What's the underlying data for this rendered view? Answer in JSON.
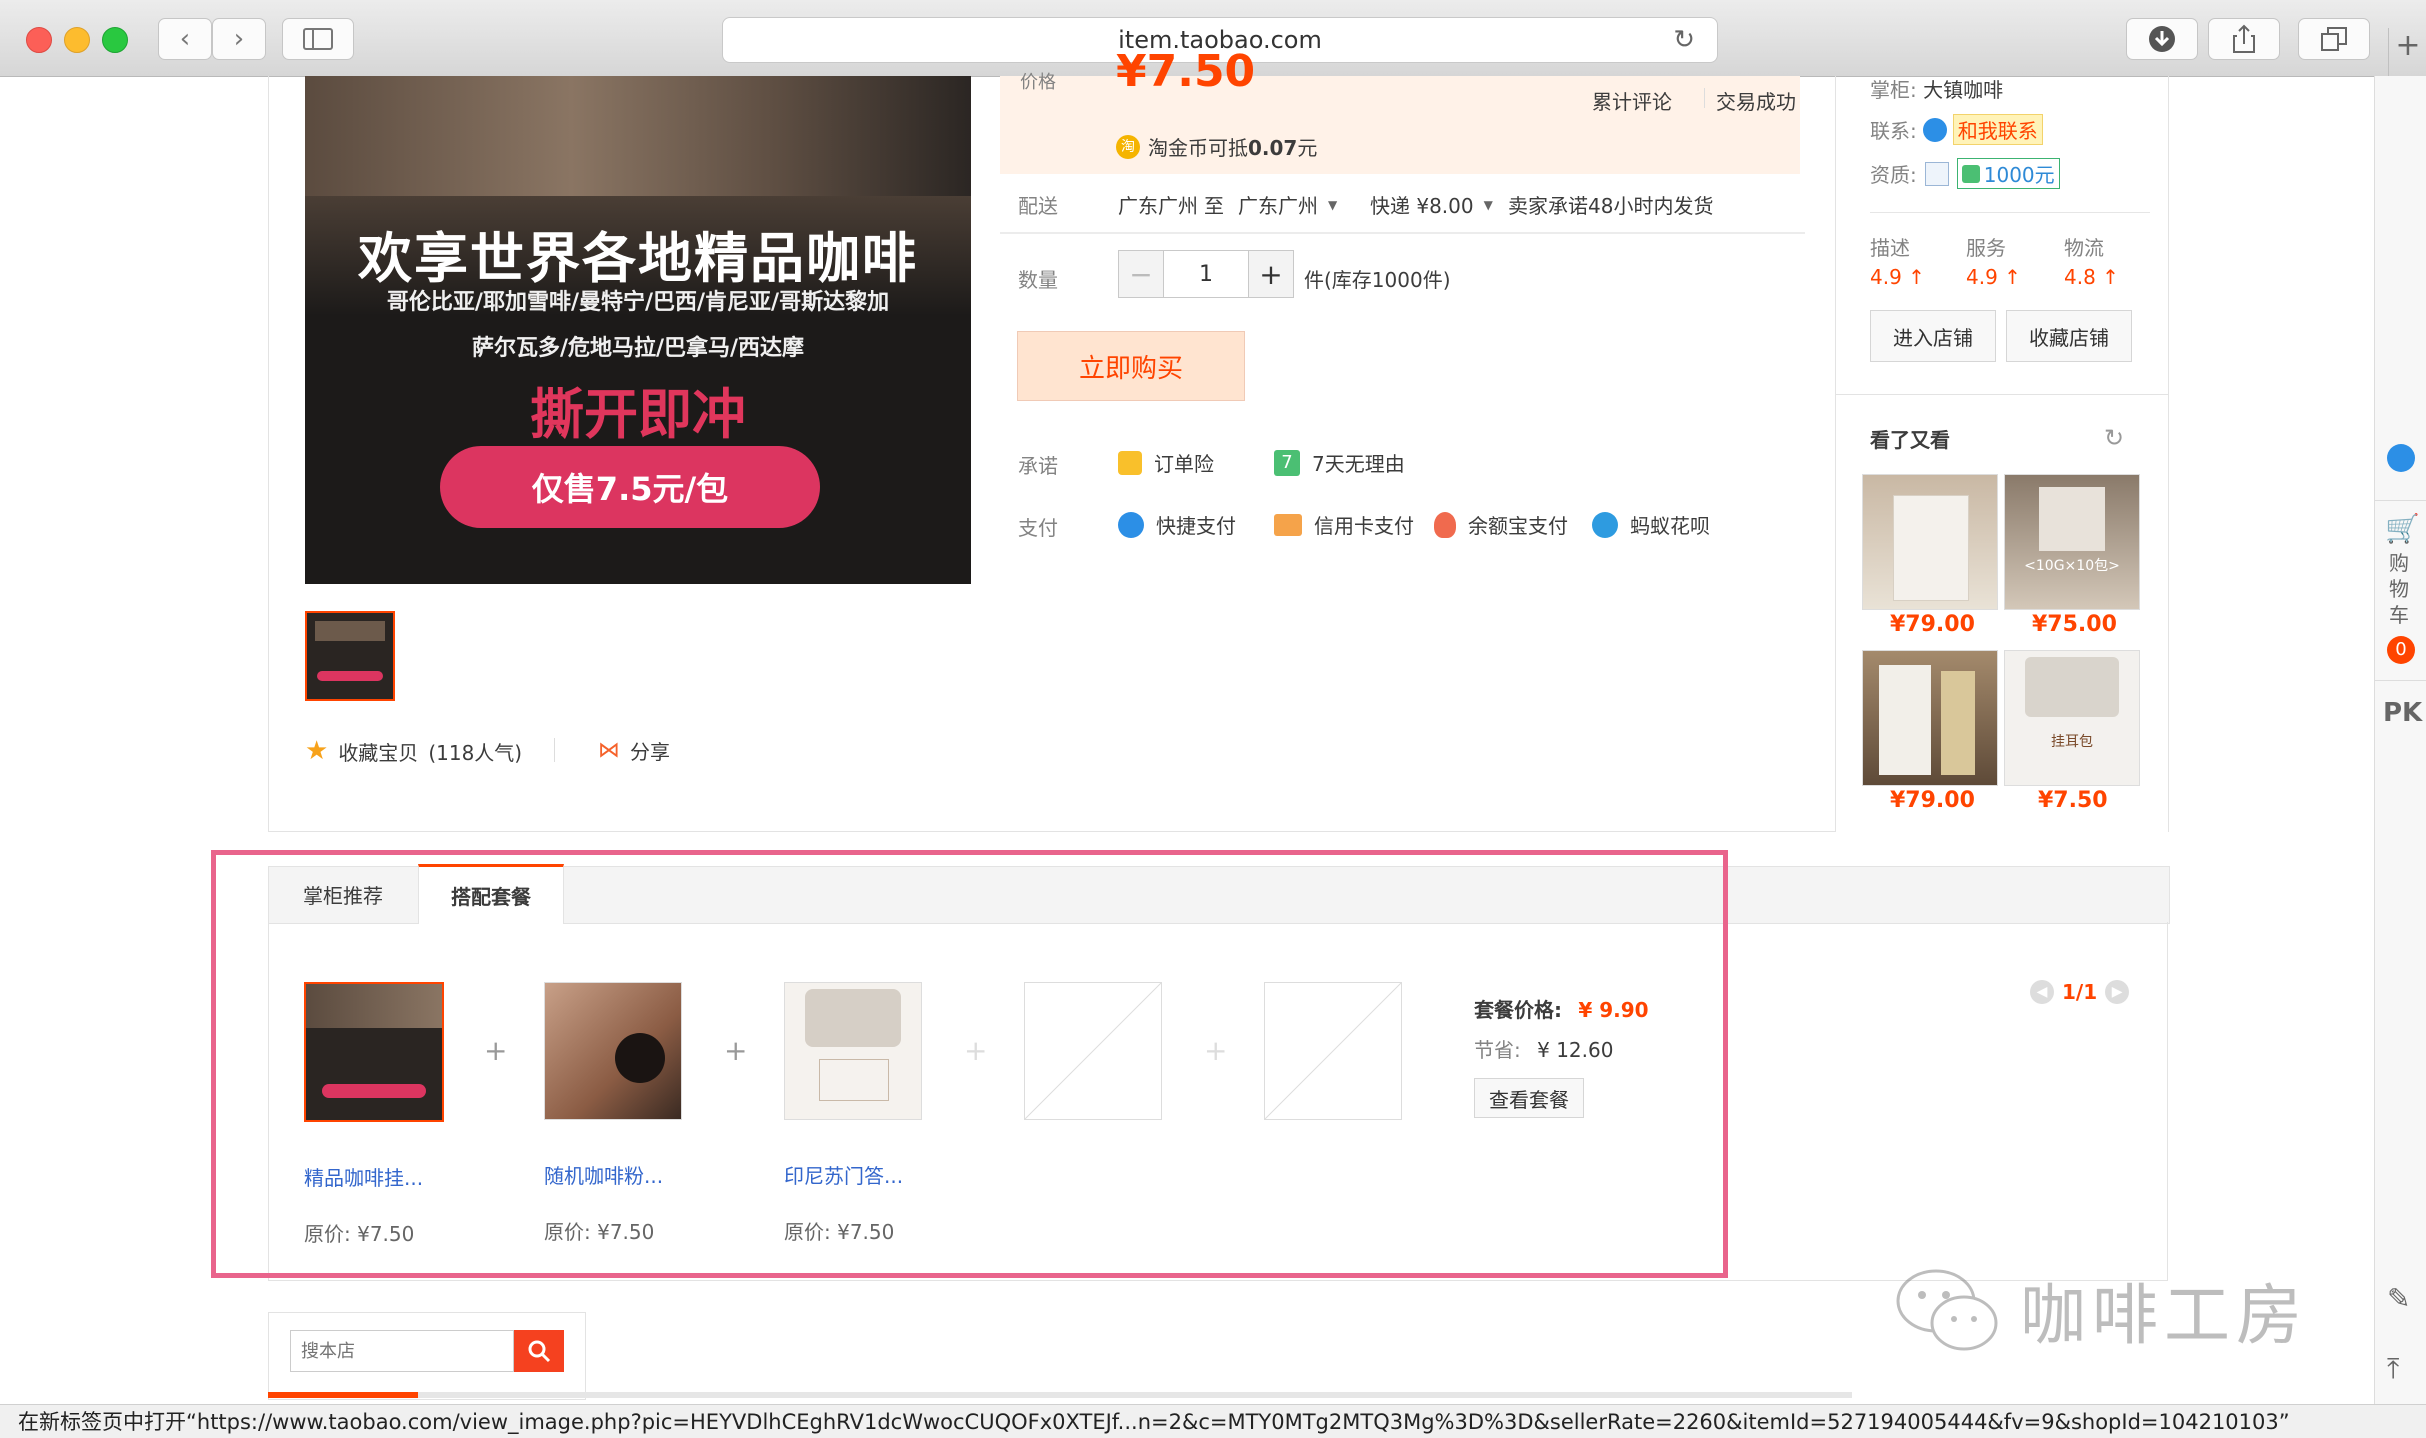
{
  "browser": {
    "url": "item.taobao.com",
    "status_text": "在新标签页中打开“https://www.taobao.com/view_image.php?pic=HEYVDlhCEghRV1dcWwocCUQOFx0XTEJf...n=2&c=MTY0MTg2MTQ3Mg%3D%3D&sellerRate=2260&itemId=527194005444&fv=9&shopId=104210103”"
  },
  "product": {
    "price_label": "价格",
    "price": "¥7.50",
    "cumulative_reviews": "累计评论",
    "transactions": "交易成功",
    "coin_text_prefix": "淘金币可抵",
    "coin_amount": "0.07",
    "coin_unit": "元",
    "shipping_label": "配送",
    "ship_from": "广东广州",
    "ship_to_word": "至",
    "ship_to": "广东广州",
    "express": "快递 ¥8.00",
    "ship_promise": "卖家承诺48小时内发货",
    "quantity_label": "数量",
    "quantity": "1",
    "stock_text": "件(库存1000件)",
    "buy_now": "立即购买",
    "promise_label": "承诺",
    "promise_items": [
      "订单险",
      "7天无理由"
    ],
    "payment_label": "支付",
    "payment_items": [
      "快捷支付",
      "信用卡支付",
      "余额宝支付",
      "蚂蚁花呗"
    ],
    "favorite_text": "收藏宝贝",
    "favorite_count": "(118人气)",
    "share_text": "分享"
  },
  "banner": {
    "headline": "欢享世界各地精品咖啡",
    "origins_line1": "哥伦比亚/耶加雪啡/曼特宁/巴西/肯尼亚/哥斯达黎加",
    "origins_line2": "萨尔瓦多/危地马拉/巴拿马/西达摩",
    "tagline": "撕开即冲",
    "price_badge": "仅售7.5元/包"
  },
  "shop": {
    "owner_label": "掌柜:",
    "owner": "大镇咖啡",
    "contact_label": "联系:",
    "contact_button": "和我联系",
    "qual_label": "资质:",
    "deposit": "1000元",
    "ratings": [
      {
        "label": "描述",
        "value": "4.9"
      },
      {
        "label": "服务",
        "value": "4.9"
      },
      {
        "label": "物流",
        "value": "4.8"
      }
    ],
    "enter_shop": "进入店铺",
    "fav_shop": "收藏店铺"
  },
  "also_viewed": {
    "title": "看了又看",
    "items": [
      {
        "price": "¥79.00"
      },
      {
        "price": "¥75.00",
        "image_text": "<10G×10包>"
      },
      {
        "price": "¥79.00"
      },
      {
        "price": "¥7.50",
        "image_text": "挂耳包"
      }
    ]
  },
  "tabs": {
    "recommend": "掌柜推荐",
    "combo": "搭配套餐"
  },
  "combo": {
    "items": [
      {
        "name": "精品咖啡挂...",
        "orig_price": "原价: ¥7.50"
      },
      {
        "name": "随机咖啡粉...",
        "orig_price": "原价: ¥7.50"
      },
      {
        "name": "印尼苏门答...",
        "orig_price": "原价: ¥7.50"
      }
    ],
    "plus": "+",
    "combo_price_label": "套餐价格:",
    "combo_price": "¥ 9.90",
    "save_label": "节省:",
    "save_amount": "¥ 12.60",
    "view_button": "查看套餐",
    "pager": "1/1"
  },
  "search": {
    "placeholder": "搜本店"
  },
  "sidebar": {
    "cart_label": "购物车",
    "cart_count": "0",
    "pk": "PK"
  },
  "watermark": "咖啡工房",
  "colors": {
    "accent": "#ff4400",
    "highlight_border": "#e9648c",
    "banner_red": "#e0365c"
  }
}
